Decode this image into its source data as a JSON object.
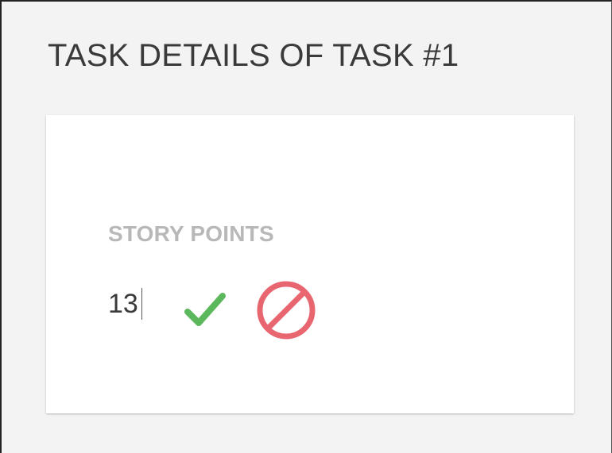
{
  "header": {
    "title": "TASK DETAILS OF TASK #1"
  },
  "editor": {
    "label": "STORY POINTS",
    "value": "13",
    "accept_icon": "checkmark-icon",
    "cancel_icon": "prohibited-icon"
  },
  "colors": {
    "accept": "#5cb85c",
    "cancel": "#e86670",
    "label": "#b8b8b8",
    "title": "#3a3a3a",
    "background": "#f3f3f3"
  }
}
